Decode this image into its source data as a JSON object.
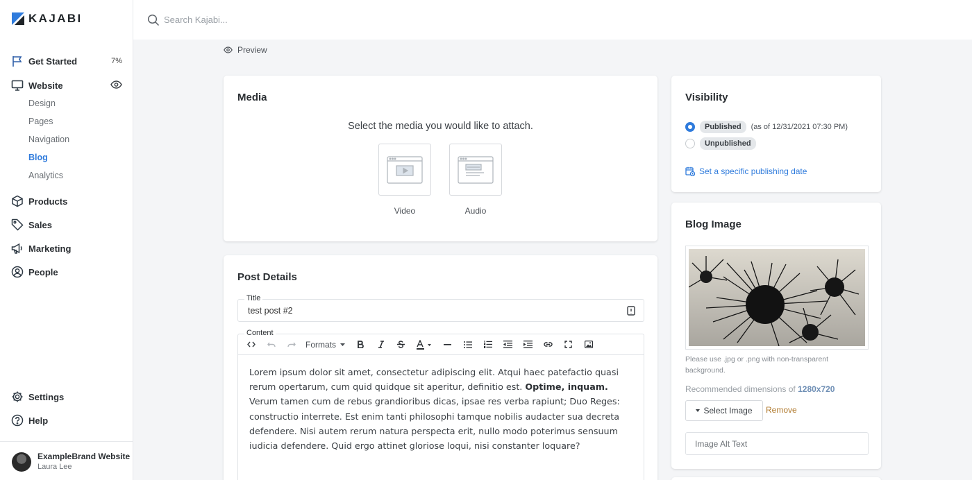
{
  "app": {
    "brand": "KAJABI"
  },
  "search": {
    "placeholder": "Search Kajabi..."
  },
  "sidebar": {
    "items": [
      {
        "label": "Get Started",
        "badge": "7%"
      },
      {
        "label": "Website"
      },
      {
        "label": "Products"
      },
      {
        "label": "Sales"
      },
      {
        "label": "Marketing"
      },
      {
        "label": "People"
      },
      {
        "label": "Settings"
      },
      {
        "label": "Help"
      }
    ],
    "website_subitems": [
      "Design",
      "Pages",
      "Navigation",
      "Blog",
      "Analytics"
    ],
    "active_subitem": "Blog",
    "account": {
      "site": "ExampleBrand Website",
      "user": "Laura Lee"
    }
  },
  "preview": {
    "label": "Preview"
  },
  "media": {
    "title": "Media",
    "prompt": "Select the media you would like to attach.",
    "options": [
      "Video",
      "Audio"
    ]
  },
  "post_details": {
    "title": "Post Details",
    "title_label": "Title",
    "title_value": "test post #2",
    "content_label": "Content",
    "formats_label": "Formats",
    "content_before": "Lorem ipsum dolor sit amet, consectetur adipiscing elit. Atqui haec patefactio quasi rerum opertarum, cum quid quidque sit aperitur, definitio est. ",
    "content_bold": "Optime, inquam.",
    "content_after": " Verum tamen cum de rebus grandioribus dicas, ipsae res verba rapiunt; Duo Reges: constructio interrete. Est enim tanti philosophi tamque nobilis audacter sua decreta defendere. Nisi autem rerum natura perspecta erit, nullo modo poterimus sensuum iudicia defendere. Quid ergo attinet gloriose loqui, nisi constanter loquare?"
  },
  "visibility": {
    "title": "Visibility",
    "published": "Published",
    "published_note": "(as of 12/31/2021 07:30 PM)",
    "unpublished": "Unpublished",
    "schedule_link": "Set a specific publishing date",
    "selected": "Published"
  },
  "blog_image": {
    "title": "Blog Image",
    "hint": "Please use .jpg or .png with non-transparent background.",
    "dims_prefix": "Recommended dimensions of ",
    "dims_value": "1280x720",
    "select_label": "Select Image",
    "remove_label": "Remove",
    "alt_placeholder": "Image Alt Text"
  },
  "colors": {
    "accent": "#2f7bdc",
    "remove": "#b07a2e",
    "logo_blue": "#2f7bdc"
  },
  "icons": [
    "kajabi-logo-icon",
    "search-icon",
    "flag-icon",
    "monitor-icon",
    "eye-icon",
    "box-icon",
    "tag-icon",
    "megaphone-icon",
    "user-circle-icon",
    "gear-icon",
    "help-icon",
    "calendar-icon",
    "document-icon"
  ]
}
